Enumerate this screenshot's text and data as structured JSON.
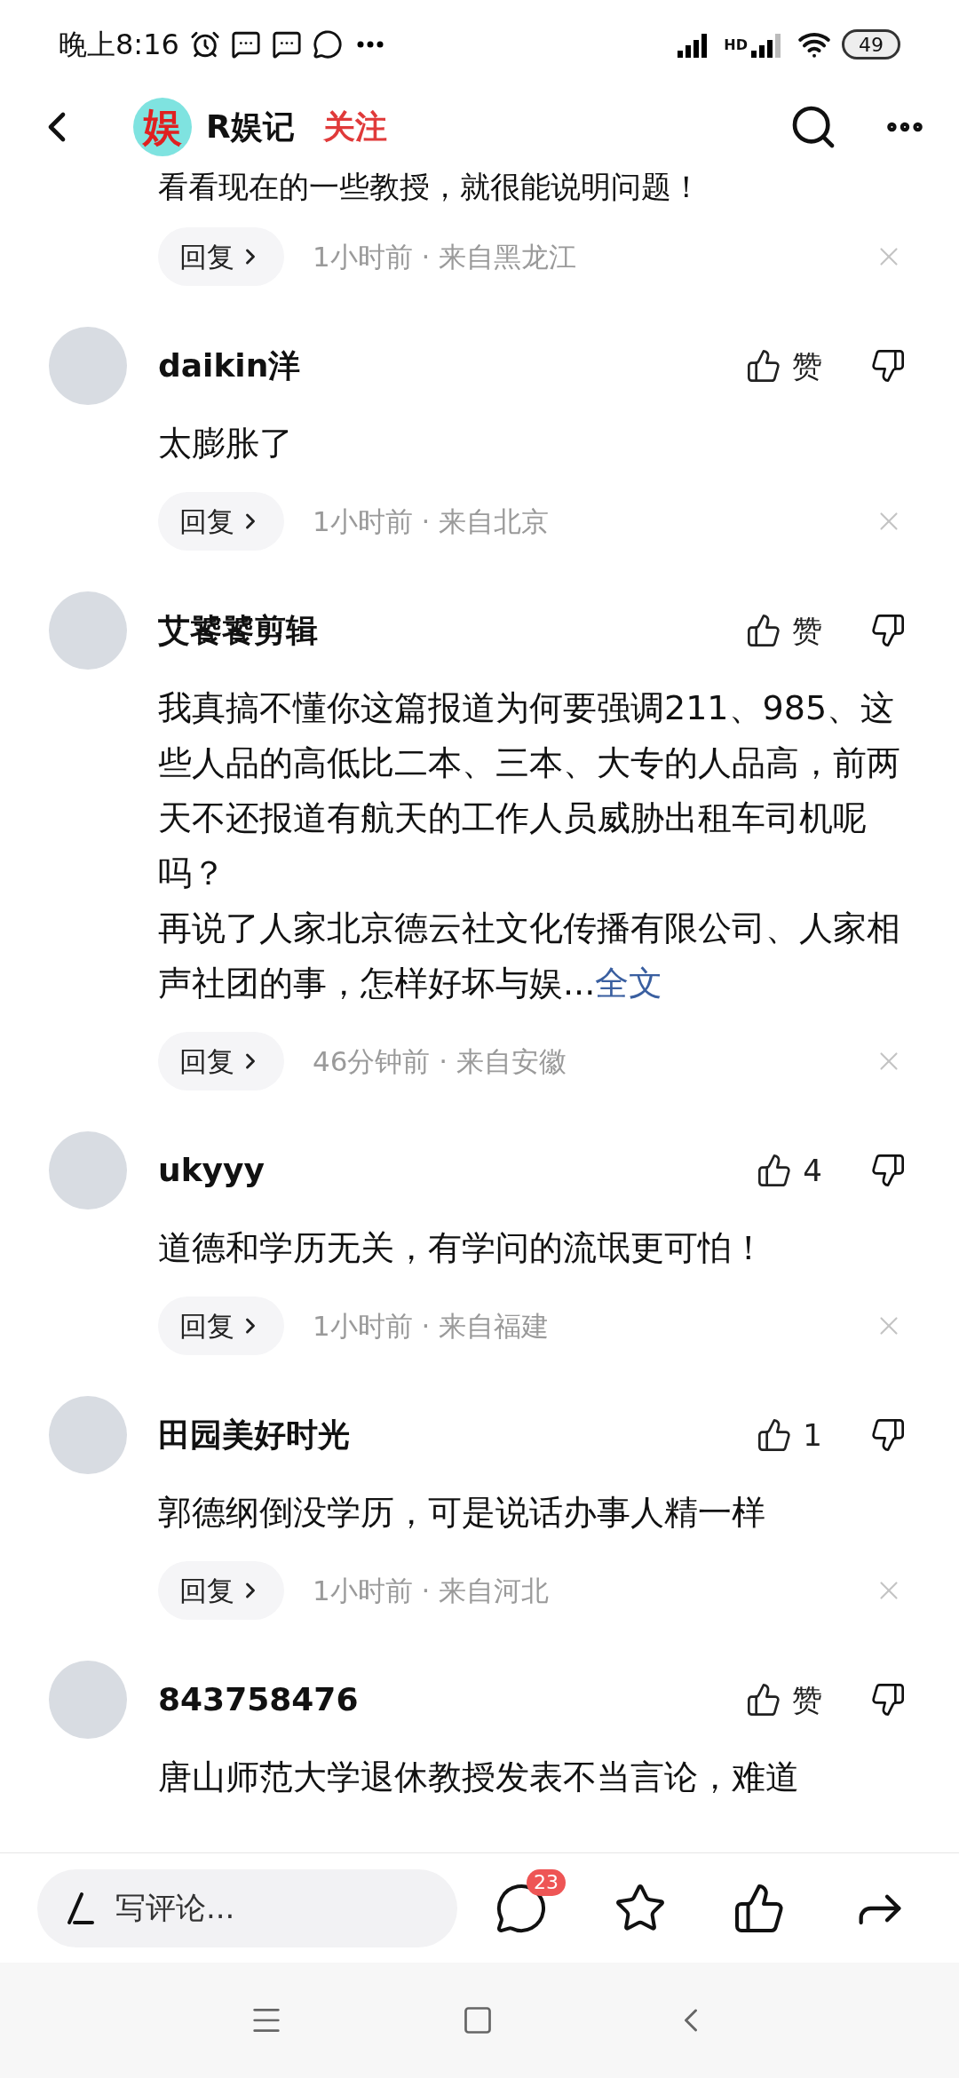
{
  "status_bar": {
    "time": "晚上8:16",
    "network_label": "HD",
    "battery": "49"
  },
  "header": {
    "logo_text": "娱",
    "channel": "R娱记",
    "follow": "关注"
  },
  "top_remnant": {
    "text": "看看现在的一些教授，就很能说明问题！",
    "reply": "回复",
    "meta": "1小时前 · 来自黑龙江"
  },
  "comments": [
    {
      "name": "daikin洋",
      "like": "赞",
      "paragraphs": [
        "太膨胀了"
      ],
      "reply": "回复",
      "meta": "1小时前 · 来自北京"
    },
    {
      "name": "艾饕饕剪辑",
      "like": "赞",
      "paragraphs": [
        "我真搞不懂你这篇报道为何要强调211、985、这些人品的高低比二本、三本、大专的人品高，前两天不还报道有航天的工作人员威胁出租车司机呢吗？",
        "再说了人家北京德云社文化传播有限公司、人家相声社团的事，怎样好坏与娱..."
      ],
      "more": "全文",
      "reply": "回复",
      "meta": "46分钟前 · 来自安徽"
    },
    {
      "name": "ukyyy",
      "like": "4",
      "paragraphs": [
        "道德和学历无关，有学问的流氓更可怕！"
      ],
      "reply": "回复",
      "meta": "1小时前 · 来自福建"
    },
    {
      "name": "田园美好时光",
      "like": "1",
      "paragraphs": [
        "郭德纲倒没学历，可是说话办事人精一样"
      ],
      "reply": "回复",
      "meta": "1小时前 · 来自河北"
    },
    {
      "name": "843758476",
      "like": "赞",
      "paragraphs": [
        "唐山师范大学退休教授发表不当言论，难道"
      ]
    }
  ],
  "bottom_bar": {
    "placeholder": "写评论...",
    "comment_count": "23"
  }
}
